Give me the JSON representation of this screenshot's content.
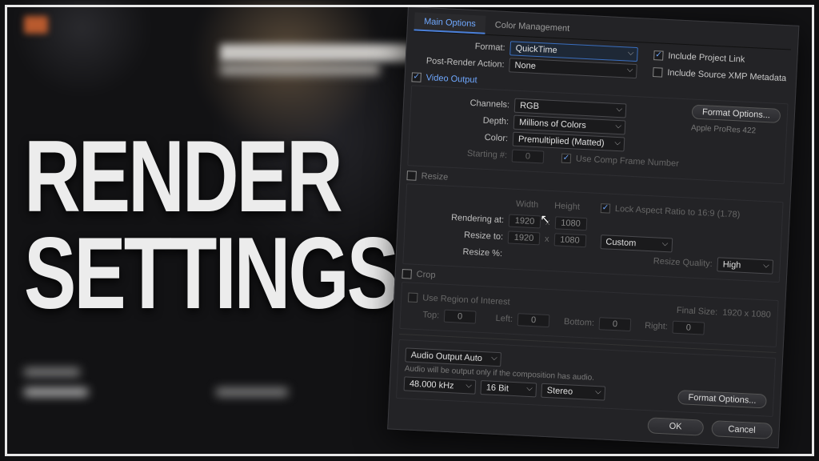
{
  "title": {
    "line1": "RENDER",
    "line2": "SETTINGS"
  },
  "tabs": {
    "main": "Main Options",
    "color": "Color Management"
  },
  "format": {
    "label": "Format:",
    "value": "QuickTime"
  },
  "postRender": {
    "label": "Post-Render Action:",
    "value": "None"
  },
  "includeProjectLink": {
    "label": "Include Project Link",
    "checked": true
  },
  "includeXMP": {
    "label": "Include Source XMP Metadata",
    "checked": false
  },
  "videoOutput": {
    "label": "Video Output",
    "checked": true
  },
  "channels": {
    "label": "Channels:",
    "value": "RGB"
  },
  "depth": {
    "label": "Depth:",
    "value": "Millions of Colors"
  },
  "color": {
    "label": "Color:",
    "value": "Premultiplied (Matted)"
  },
  "starting": {
    "label": "Starting #:",
    "value": "0"
  },
  "useCompFrame": {
    "label": "Use Comp Frame Number",
    "checked": true
  },
  "formatOptionsBtn": "Format Options...",
  "codecNote": "Apple ProRes 422",
  "resize": {
    "label": "Resize",
    "checked": false,
    "widthLabel": "Width",
    "heightLabel": "Height",
    "lockAspect": {
      "label": "Lock Aspect Ratio to 16:9 (1.78)",
      "checked": true
    },
    "renderingAtLabel": "Rendering at:",
    "renderW": "1920",
    "renderH": "1080",
    "resizeToLabel": "Resize to:",
    "resizeW": "1920",
    "resizeH": "1080",
    "preset": "Custom",
    "resizePctLabel": "Resize %:",
    "resizeQualityLabel": "Resize Quality:",
    "resizeQuality": "High",
    "x": "x"
  },
  "crop": {
    "label": "Crop",
    "checked": false,
    "useROI": {
      "label": "Use Region of Interest",
      "checked": false
    },
    "finalSizeLabel": "Final Size:",
    "finalSize": "1920 x 1080",
    "topLabel": "Top:",
    "top": "0",
    "leftLabel": "Left:",
    "left": "0",
    "bottomLabel": "Bottom:",
    "bottom": "0",
    "rightLabel": "Right:",
    "right": "0"
  },
  "audio": {
    "outputLabel": "Audio Output Auto",
    "note": "Audio will be output only if the composition has audio.",
    "rate": "48.000 kHz",
    "bit": "16 Bit",
    "channels": "Stereo",
    "formatOptionsBtn": "Format Options..."
  },
  "buttons": {
    "ok": "OK",
    "cancel": "Cancel"
  }
}
